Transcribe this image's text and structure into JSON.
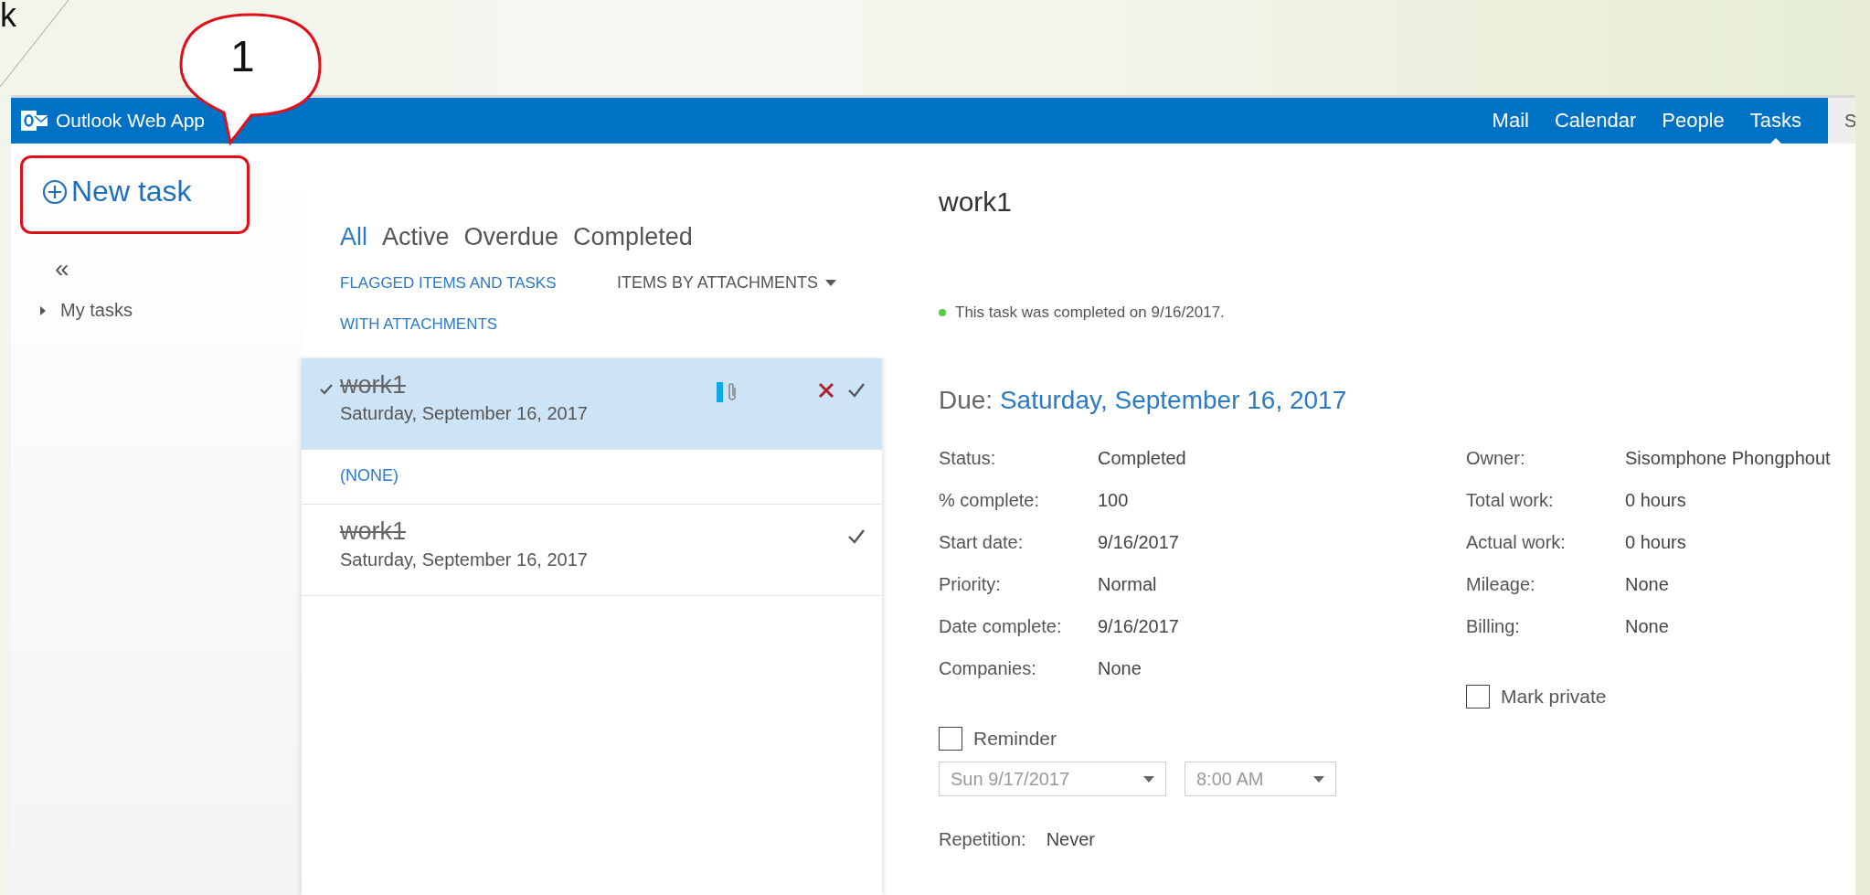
{
  "slide": {
    "title_fragment": "k"
  },
  "callout": {
    "label": "1",
    "highlighted": true
  },
  "header": {
    "app_name": "Outlook Web App",
    "nav": [
      {
        "label": "Mail",
        "selected": false
      },
      {
        "label": "Calendar",
        "selected": false
      },
      {
        "label": "People",
        "selected": false
      },
      {
        "label": "Tasks",
        "selected": true
      }
    ],
    "cut_text": "S"
  },
  "sidebar": {
    "new_task": "New task",
    "collapse": "«",
    "folders": [
      {
        "label": "My tasks",
        "expanded": false
      }
    ]
  },
  "filters": [
    {
      "label": "All",
      "selected": true
    },
    {
      "label": "Active",
      "selected": false
    },
    {
      "label": "Overdue",
      "selected": false
    },
    {
      "label": "Completed",
      "selected": false
    }
  ],
  "list_header": {
    "title": "FLAGGED ITEMS AND TASKS WITH ATTACHMENTS",
    "sort": "ITEMS BY ATTACHMENTS"
  },
  "list": [
    {
      "kind": "task",
      "title": "work1",
      "date": "Saturday, September 16, 2017",
      "selected": true,
      "completed": true,
      "attachment": true
    },
    {
      "kind": "group",
      "label": "(NONE)"
    },
    {
      "kind": "task",
      "title": "work1",
      "date": "Saturday, September 16, 2017",
      "selected": false,
      "completed": true,
      "attachment": false
    }
  ],
  "detail": {
    "title": "work1",
    "notice": "This task was completed on 9/16/2017.",
    "due_label": "Due:",
    "due_date": "Saturday, September 16, 2017",
    "fields_left": [
      {
        "label": "Status:",
        "value": "Completed"
      },
      {
        "label": "% complete:",
        "value": "100"
      },
      {
        "label": "Start date:",
        "value": "9/16/2017"
      },
      {
        "label": "Priority:",
        "value": "Normal"
      },
      {
        "label": "Date complete:",
        "value": "9/16/2017"
      },
      {
        "label": "Companies:",
        "value": "None"
      }
    ],
    "fields_right": [
      {
        "label": "Owner:",
        "value": "Sisomphone Phongphout"
      },
      {
        "label": "Total work:",
        "value": "0 hours"
      },
      {
        "label": "Actual work:",
        "value": "0 hours"
      },
      {
        "label": "Mileage:",
        "value": "None"
      },
      {
        "label": "Billing:",
        "value": "None"
      }
    ],
    "reminder": {
      "label": "Reminder",
      "checked": false
    },
    "mark_private": {
      "label": "Mark private",
      "checked": false
    },
    "reminder_date": {
      "value": "Sun 9/17/2017",
      "disabled": true
    },
    "reminder_time": {
      "value": "8:00 AM",
      "disabled": true
    },
    "repetition": {
      "label": "Repetition:",
      "value": "Never"
    }
  }
}
